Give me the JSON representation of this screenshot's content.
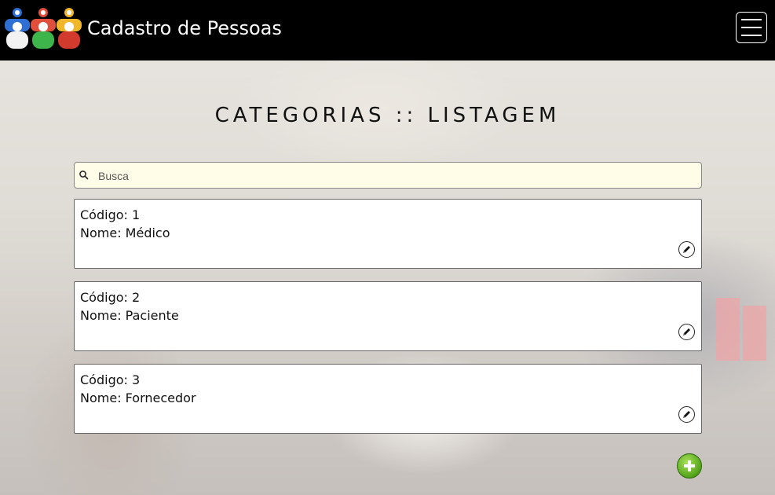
{
  "header": {
    "brand": "Cadastro de Pessoas",
    "logo_icon": "people-group-icon",
    "menu_icon": "hamburger-menu-icon"
  },
  "main": {
    "title": "CATEGORIAS :: LISTAGEM",
    "search": {
      "placeholder": "Busca",
      "value": "",
      "icon": "search-icon"
    },
    "categories": [
      {
        "codigo_label": "Código: 1",
        "nome_label": "Nome: Médico"
      },
      {
        "codigo_label": "Código: 2",
        "nome_label": "Nome: Paciente"
      },
      {
        "codigo_label": "Código: 3",
        "nome_label": "Nome: Fornecedor"
      }
    ],
    "add_icon": "add-icon",
    "edit_icon": "edit-pencil-icon"
  },
  "colors": {
    "header_bg": "#000000",
    "search_bg": "#fffde7",
    "add_button": "#52a31a"
  }
}
